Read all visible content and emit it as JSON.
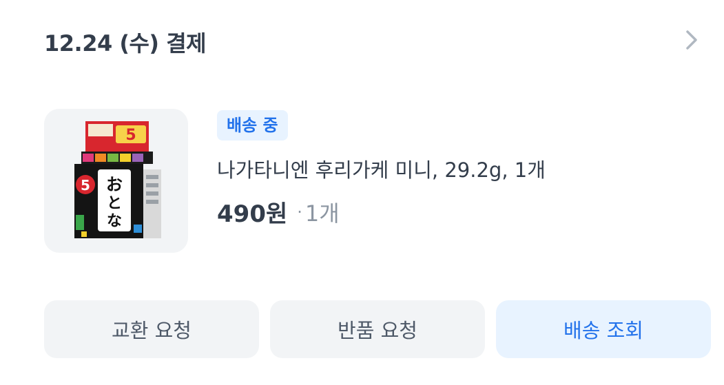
{
  "order": {
    "date_text": "12.24 (수) 결제",
    "detail_icon": "chevron-right-icon"
  },
  "product": {
    "image_icon": "furikake-package-image",
    "status_badge": "배송 중",
    "name": "나가타니엔 후리가케 미니, 29.2g, 1개",
    "price": "490원",
    "separator": "·",
    "quantity": "1개"
  },
  "actions": {
    "exchange_label": "교환 요청",
    "return_label": "반품 요청",
    "track_label": "배송 조회"
  },
  "colors": {
    "accent": "#2272eb",
    "accent_bg": "#e8f3ff",
    "neutral_bg": "#f2f4f6",
    "text_primary": "#333d4b",
    "text_secondary": "#8b95a1"
  }
}
